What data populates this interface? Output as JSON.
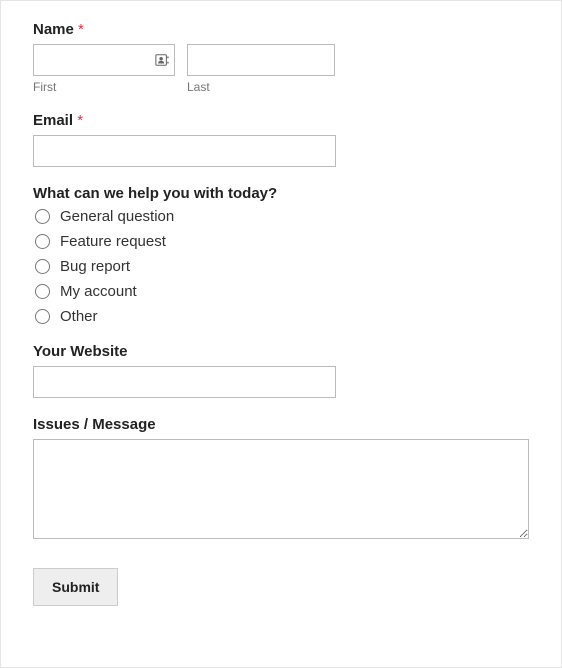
{
  "name": {
    "label": "Name",
    "required_mark": "*",
    "first_sublabel": "First",
    "last_sublabel": "Last",
    "first_value": "",
    "last_value": ""
  },
  "email": {
    "label": "Email",
    "required_mark": "*",
    "value": ""
  },
  "help_topic": {
    "label": "What can we help you with today?",
    "options": [
      "General question",
      "Feature request",
      "Bug report",
      "My account",
      "Other"
    ]
  },
  "website": {
    "label": "Your Website",
    "value": ""
  },
  "message": {
    "label": "Issues / Message",
    "value": ""
  },
  "submit": {
    "label": "Submit"
  }
}
